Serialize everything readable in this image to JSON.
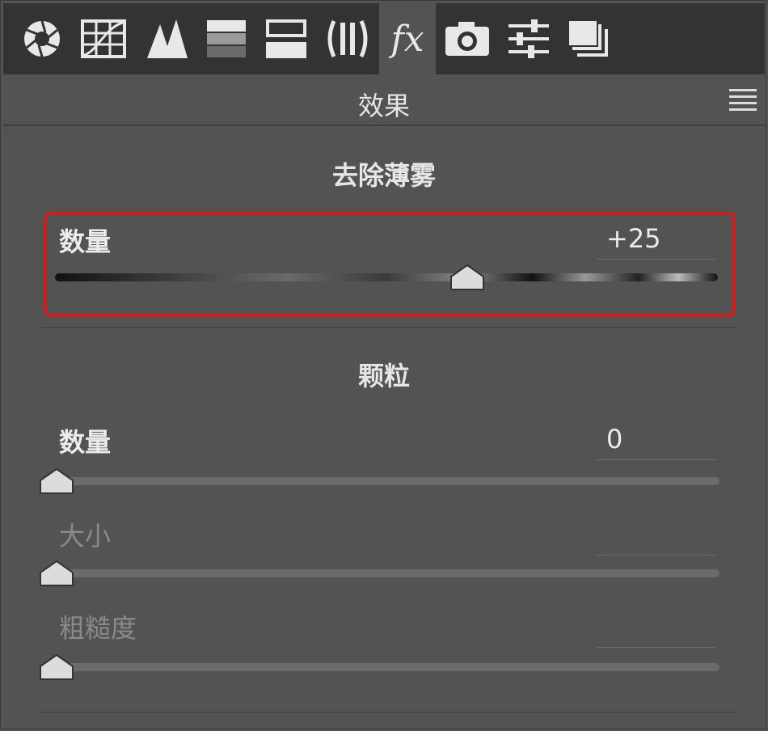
{
  "toolbar": {
    "icons": [
      "aperture-icon",
      "tone-curve-icon",
      "detail-icon",
      "hsl-icon",
      "split-toning-icon",
      "lens-corrections-icon",
      "fx-icon",
      "camera-calibration-icon",
      "presets-icon",
      "snapshots-icon"
    ],
    "active": "fx-icon",
    "fx_label": "fx"
  },
  "panel": {
    "title": "效果",
    "menu_icon": "menu-icon"
  },
  "dehaze": {
    "title": "去除薄雾",
    "amount_label": "数量",
    "amount_value": "+25",
    "amount_numeric": 25,
    "range": [
      -100,
      100
    ]
  },
  "grain": {
    "title": "颗粒",
    "amount_label": "数量",
    "amount_value": "0",
    "size_label": "大小",
    "size_value": "",
    "roughness_label": "粗糙度",
    "roughness_value": ""
  },
  "colors": {
    "highlight_border": "#d01c1c",
    "panel_bg": "#535353",
    "toolbar_bg": "#333333"
  }
}
